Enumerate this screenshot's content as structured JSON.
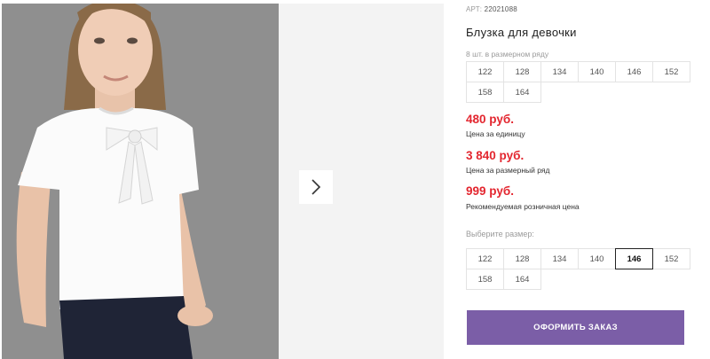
{
  "product": {
    "sku_label": "АРТ:",
    "sku_value": "22021088",
    "title": "Блузка для девочки"
  },
  "size_row": {
    "note": "8 шт. в размерном ряду",
    "sizes": [
      "122",
      "128",
      "134",
      "140",
      "146",
      "152",
      "158",
      "164"
    ]
  },
  "prices": {
    "unit_price": "480 руб.",
    "unit_label": "Цена за единицу",
    "row_price": "3 840 руб.",
    "row_label": "Цена за размерный ряд",
    "retail_price": "999 руб.",
    "retail_label": "Рекомендуемая розничная цена"
  },
  "size_picker": {
    "label": "Выберите размер:",
    "sizes": [
      "122",
      "128",
      "134",
      "140",
      "146",
      "152",
      "158",
      "164"
    ],
    "selected": "146"
  },
  "order_button": {
    "label": "ОФОРМИТЬ ЗАКАЗ"
  },
  "gallery": {
    "next_icon": "chevron-right-icon",
    "photo": "product-photo-girl-white-blouse"
  },
  "colors": {
    "accent": "#7b5ea7",
    "price": "#e3262f"
  }
}
